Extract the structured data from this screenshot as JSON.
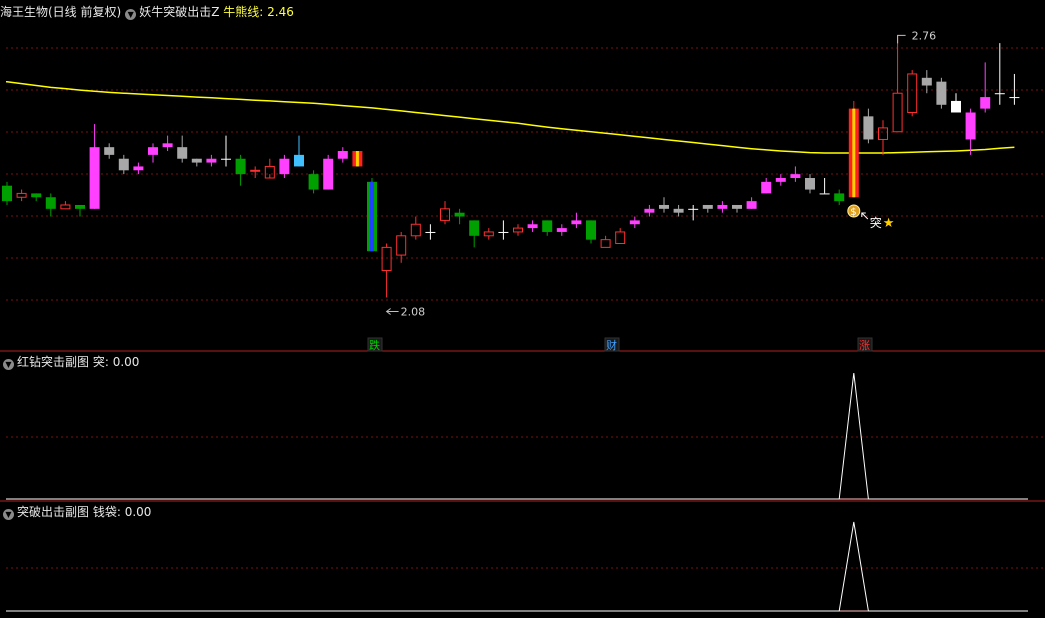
{
  "header": {
    "stock_name": "海王生物(日线 前复权)",
    "indicator_name": "妖牛突破出击Z",
    "line_label": "牛熊线:",
    "line_value": "2.46"
  },
  "panel2": {
    "title": "红钻突击副图",
    "label": "突:",
    "value": "0.00"
  },
  "panel3": {
    "title": "突破出击副图",
    "label": "钱袋:",
    "value": "0.00"
  },
  "colors": {
    "up": "#ff3030",
    "down": "#00a000",
    "magenta": "#ff40ff",
    "gray": "#a8a8a8",
    "cyan": "#40c0ff",
    "white": "#ffffff",
    "line": "#ffff00",
    "grid": "#7a1010"
  },
  "chart_data": [
    {
      "type": "candlestick",
      "annotations": {
        "high_label": "2.76",
        "low_label": "2.08",
        "signal_label": "突",
        "signal_star": "★",
        "markers": [
          {
            "x": 50,
            "text": "跌",
            "color": "#00d000"
          },
          {
            "x": 84,
            "text": "财",
            "color": "#40a0ff"
          },
          {
            "x": 121,
            "text": "涨",
            "color": "#ff3030"
          }
        ]
      },
      "ylim": [
        1.98,
        2.8
      ],
      "candles": [
        {
          "o": 2.37,
          "c": 2.33,
          "h": 2.38,
          "l": 2.32,
          "k": "d"
        },
        {
          "o": 2.34,
          "c": 2.35,
          "h": 2.36,
          "l": 2.33,
          "k": "u"
        },
        {
          "o": 2.34,
          "c": 2.35,
          "h": 2.35,
          "l": 2.33,
          "k": "d"
        },
        {
          "o": 2.34,
          "c": 2.31,
          "h": 2.35,
          "l": 2.29,
          "k": "d"
        },
        {
          "o": 2.31,
          "c": 2.32,
          "h": 2.33,
          "l": 2.31,
          "k": "u"
        },
        {
          "o": 2.32,
          "c": 2.31,
          "h": 2.32,
          "l": 2.29,
          "k": "d"
        },
        {
          "o": 2.31,
          "c": 2.47,
          "h": 2.53,
          "l": 2.31,
          "k": "m"
        },
        {
          "o": 2.45,
          "c": 2.47,
          "h": 2.48,
          "l": 2.44,
          "k": "g"
        },
        {
          "o": 2.44,
          "c": 2.41,
          "h": 2.45,
          "l": 2.4,
          "k": "g"
        },
        {
          "o": 2.41,
          "c": 2.42,
          "h": 2.43,
          "l": 2.4,
          "k": "m"
        },
        {
          "o": 2.45,
          "c": 2.47,
          "h": 2.48,
          "l": 2.43,
          "k": "m"
        },
        {
          "o": 2.47,
          "c": 2.48,
          "h": 2.5,
          "l": 2.46,
          "k": "m"
        },
        {
          "o": 2.47,
          "c": 2.44,
          "h": 2.5,
          "l": 2.43,
          "k": "g"
        },
        {
          "o": 2.44,
          "c": 2.43,
          "h": 2.44,
          "l": 2.42,
          "k": "g"
        },
        {
          "o": 2.44,
          "c": 2.43,
          "h": 2.45,
          "l": 2.42,
          "k": "m"
        },
        {
          "o": 2.44,
          "c": 2.44,
          "h": 2.5,
          "l": 2.42,
          "k": "w"
        },
        {
          "o": 2.44,
          "c": 2.4,
          "h": 2.45,
          "l": 2.37,
          "k": "d"
        },
        {
          "o": 2.41,
          "c": 2.41,
          "h": 2.42,
          "l": 2.39,
          "k": "u"
        },
        {
          "o": 2.39,
          "c": 2.42,
          "h": 2.44,
          "l": 2.4,
          "k": "u"
        },
        {
          "o": 2.4,
          "c": 2.44,
          "h": 2.45,
          "l": 2.39,
          "k": "m"
        },
        {
          "o": 2.42,
          "c": 2.45,
          "h": 2.5,
          "l": 2.42,
          "k": "c"
        },
        {
          "o": 2.4,
          "c": 2.36,
          "h": 2.41,
          "l": 2.35,
          "k": "d"
        },
        {
          "o": 2.36,
          "c": 2.44,
          "h": 2.45,
          "l": 2.36,
          "k": "m"
        },
        {
          "o": 2.44,
          "c": 2.46,
          "h": 2.47,
          "l": 2.43,
          "k": "m"
        },
        {
          "o": 2.42,
          "c": 2.46,
          "h": 2.46,
          "l": 2.42,
          "k": "s"
        },
        {
          "o": 2.38,
          "c": 2.2,
          "h": 2.39,
          "l": 2.2,
          "k": "b"
        },
        {
          "o": 2.15,
          "c": 2.21,
          "h": 2.22,
          "l": 2.08,
          "k": "u"
        },
        {
          "o": 2.19,
          "c": 2.24,
          "h": 2.25,
          "l": 2.17,
          "k": "u"
        },
        {
          "o": 2.24,
          "c": 2.27,
          "h": 2.29,
          "l": 2.23,
          "k": "u"
        },
        {
          "o": 2.25,
          "c": 2.25,
          "h": 2.27,
          "l": 2.23,
          "k": "w"
        },
        {
          "o": 2.28,
          "c": 2.31,
          "h": 2.33,
          "l": 2.27,
          "k": "u"
        },
        {
          "o": 2.3,
          "c": 2.29,
          "h": 2.31,
          "l": 2.27,
          "k": "d"
        },
        {
          "o": 2.28,
          "c": 2.24,
          "h": 2.28,
          "l": 2.21,
          "k": "d"
        },
        {
          "o": 2.24,
          "c": 2.25,
          "h": 2.26,
          "l": 2.23,
          "k": "u"
        },
        {
          "o": 2.25,
          "c": 2.25,
          "h": 2.28,
          "l": 2.23,
          "k": "w"
        },
        {
          "o": 2.25,
          "c": 2.26,
          "h": 2.27,
          "l": 2.24,
          "k": "u"
        },
        {
          "o": 2.26,
          "c": 2.27,
          "h": 2.28,
          "l": 2.25,
          "k": "m"
        },
        {
          "o": 2.28,
          "c": 2.25,
          "h": 2.28,
          "l": 2.24,
          "k": "d"
        },
        {
          "o": 2.25,
          "c": 2.26,
          "h": 2.27,
          "l": 2.24,
          "k": "m"
        },
        {
          "o": 2.27,
          "c": 2.28,
          "h": 2.3,
          "l": 2.26,
          "k": "m"
        },
        {
          "o": 2.28,
          "c": 2.23,
          "h": 2.28,
          "l": 2.22,
          "k": "d"
        },
        {
          "o": 2.21,
          "c": 2.23,
          "h": 2.24,
          "l": 2.21,
          "k": "u"
        },
        {
          "o": 2.22,
          "c": 2.25,
          "h": 2.26,
          "l": 2.22,
          "k": "u"
        },
        {
          "o": 2.27,
          "c": 2.28,
          "h": 2.29,
          "l": 2.26,
          "k": "m"
        },
        {
          "o": 2.3,
          "c": 2.31,
          "h": 2.32,
          "l": 2.29,
          "k": "m"
        },
        {
          "o": 2.31,
          "c": 2.32,
          "h": 2.34,
          "l": 2.3,
          "k": "g"
        },
        {
          "o": 2.31,
          "c": 2.3,
          "h": 2.32,
          "l": 2.29,
          "k": "g"
        },
        {
          "o": 2.31,
          "c": 2.31,
          "h": 2.32,
          "l": 2.28,
          "k": "w"
        },
        {
          "o": 2.31,
          "c": 2.32,
          "h": 2.32,
          "l": 2.3,
          "k": "g"
        },
        {
          "o": 2.31,
          "c": 2.32,
          "h": 2.33,
          "l": 2.3,
          "k": "m"
        },
        {
          "o": 2.32,
          "c": 2.31,
          "h": 2.32,
          "l": 2.3,
          "k": "g"
        },
        {
          "o": 2.31,
          "c": 2.33,
          "h": 2.34,
          "l": 2.31,
          "k": "m"
        },
        {
          "o": 2.35,
          "c": 2.38,
          "h": 2.39,
          "l": 2.35,
          "k": "m"
        },
        {
          "o": 2.38,
          "c": 2.39,
          "h": 2.4,
          "l": 2.37,
          "k": "m"
        },
        {
          "o": 2.39,
          "c": 2.4,
          "h": 2.42,
          "l": 2.38,
          "k": "m"
        },
        {
          "o": 2.39,
          "c": 2.36,
          "h": 2.4,
          "l": 2.35,
          "k": "g"
        },
        {
          "o": 2.35,
          "c": 2.35,
          "h": 2.39,
          "l": 2.35,
          "k": "w"
        },
        {
          "o": 2.33,
          "c": 2.35,
          "h": 2.36,
          "l": 2.32,
          "k": "d"
        },
        {
          "o": 2.34,
          "c": 2.57,
          "h": 2.59,
          "l": 2.34,
          "k": "s"
        },
        {
          "o": 2.55,
          "c": 2.49,
          "h": 2.57,
          "l": 2.48,
          "k": "g"
        },
        {
          "o": 2.49,
          "c": 2.52,
          "h": 2.54,
          "l": 2.45,
          "k": "u"
        },
        {
          "o": 2.51,
          "c": 2.61,
          "h": 2.76,
          "l": 2.51,
          "k": "u"
        },
        {
          "o": 2.56,
          "c": 2.66,
          "h": 2.67,
          "l": 2.55,
          "k": "u"
        },
        {
          "o": 2.63,
          "c": 2.65,
          "h": 2.67,
          "l": 2.61,
          "k": "g"
        },
        {
          "o": 2.64,
          "c": 2.58,
          "h": 2.65,
          "l": 2.57,
          "k": "g"
        },
        {
          "o": 2.56,
          "c": 2.59,
          "h": 2.61,
          "l": 2.56,
          "k": "w"
        },
        {
          "o": 2.56,
          "c": 2.49,
          "h": 2.57,
          "l": 2.45,
          "k": "m"
        },
        {
          "o": 2.57,
          "c": 2.6,
          "h": 2.69,
          "l": 2.56,
          "k": "m"
        },
        {
          "o": 2.61,
          "c": 2.61,
          "h": 2.74,
          "l": 2.58,
          "k": "w"
        },
        {
          "o": 2.6,
          "c": 2.6,
          "h": 2.66,
          "l": 2.58,
          "k": "w"
        }
      ],
      "ma_line": [
        2.64,
        2.635,
        2.63,
        2.625,
        2.622,
        2.618,
        2.615,
        2.612,
        2.61,
        2.608,
        2.606,
        2.604,
        2.602,
        2.6,
        2.598,
        2.596,
        2.594,
        2.592,
        2.59,
        2.588,
        2.586,
        2.584,
        2.581,
        2.578,
        2.575,
        2.572,
        2.568,
        2.564,
        2.56,
        2.556,
        2.552,
        2.548,
        2.544,
        2.54,
        2.536,
        2.532,
        2.527,
        2.522,
        2.518,
        2.514,
        2.51,
        2.506,
        2.502,
        2.498,
        2.494,
        2.49,
        2.486,
        2.482,
        2.478,
        2.474,
        2.47,
        2.466,
        2.463,
        2.46,
        2.458,
        2.456,
        2.455,
        2.455,
        2.455,
        2.455,
        2.455,
        2.456,
        2.457,
        2.458,
        2.459,
        2.46,
        2.462,
        2.464,
        2.467,
        2.47
      ]
    },
    {
      "type": "line",
      "title": "红钻突击副图",
      "series": [
        {
          "name": "突",
          "values": [
            0,
            0,
            0,
            0,
            0,
            0,
            0,
            0,
            0,
            0,
            0,
            0,
            0,
            0,
            0,
            0,
            0,
            0,
            0,
            0,
            0,
            0,
            0,
            0,
            0,
            0,
            0,
            0,
            0,
            0,
            0,
            0,
            0,
            0,
            0,
            0,
            0,
            0,
            0,
            0,
            0,
            0,
            0,
            0,
            0,
            0,
            0,
            0,
            0,
            0,
            0,
            0,
            0,
            0,
            0,
            0,
            0,
            0,
            1,
            0,
            0,
            0,
            0,
            0,
            0,
            0,
            0,
            0,
            0,
            0
          ]
        }
      ]
    },
    {
      "type": "line",
      "title": "突破出击副图",
      "series": [
        {
          "name": "钱袋",
          "values": [
            0,
            0,
            0,
            0,
            0,
            0,
            0,
            0,
            0,
            0,
            0,
            0,
            0,
            0,
            0,
            0,
            0,
            0,
            0,
            0,
            0,
            0,
            0,
            0,
            0,
            0,
            0,
            0,
            0,
            0,
            0,
            0,
            0,
            0,
            0,
            0,
            0,
            0,
            0,
            0,
            0,
            0,
            0,
            0,
            0,
            0,
            0,
            0,
            0,
            0,
            0,
            0,
            0,
            0,
            0,
            0,
            0,
            0,
            1,
            0,
            0,
            0,
            0,
            0,
            0,
            0,
            0,
            0,
            0,
            0
          ]
        }
      ]
    }
  ]
}
